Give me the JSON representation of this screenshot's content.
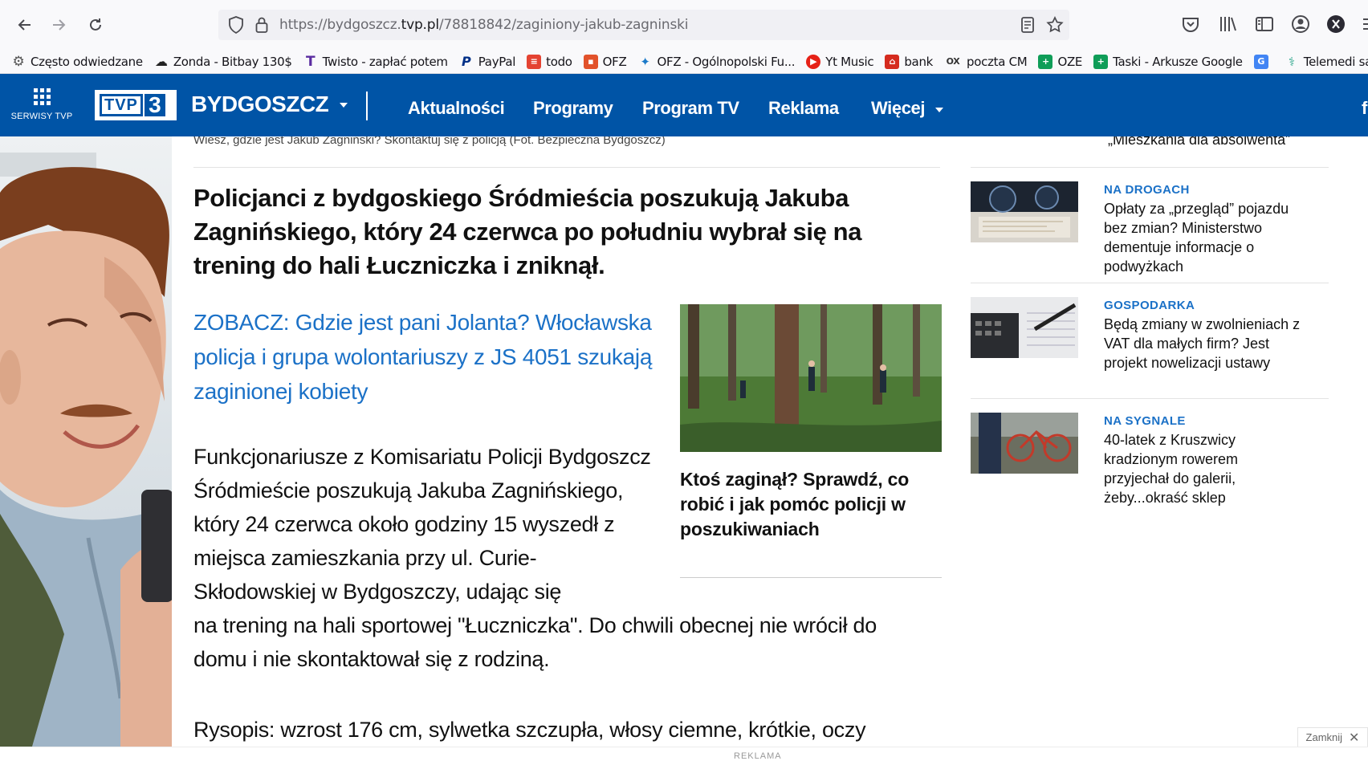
{
  "browser": {
    "url_prefix": "https://bydgoszcz.",
    "url_domain": "tvp.pl",
    "url_path": "/78818842/zaginiony-jakub-zagninski",
    "bookmarks": [
      {
        "label": "Często odwiedzane",
        "icon": "gear-icon",
        "color": "#555555"
      },
      {
        "label": "Zonda - Bitbay 130$",
        "icon": "zonda-icon",
        "color": "#222222"
      },
      {
        "label": "Twisto - zapłać potem",
        "icon": "twisto-icon",
        "color": "#5a2ca0"
      },
      {
        "label": "PayPal",
        "icon": "paypal-icon",
        "color": "#003087"
      },
      {
        "label": "todo",
        "icon": "todo-icon",
        "color": "#e44332"
      },
      {
        "label": "OFZ",
        "icon": "ofz-icon",
        "color": "#e2522b"
      },
      {
        "label": "OFZ - Ogólnopolski Fu...",
        "icon": "ofz2-icon",
        "color": "#1c7ac9"
      },
      {
        "label": "Yt Music",
        "icon": "youtube-music-icon",
        "color": "#e62117"
      },
      {
        "label": "bank",
        "icon": "bank-icon",
        "color": "#d52b1e"
      },
      {
        "label": "poczta CM",
        "icon": "mail-icon",
        "color": "#333333"
      },
      {
        "label": "OZE",
        "icon": "sheets-icon",
        "color": "#0f9d58"
      },
      {
        "label": "Taski - Arkusze Google",
        "icon": "sheets-icon",
        "color": "#0f9d58"
      },
      {
        "label": "",
        "icon": "translate-icon",
        "color": "#4285f4"
      },
      {
        "label": "Telemedi santander",
        "icon": "stethoscope-icon",
        "color": "#2aa58a"
      }
    ]
  },
  "header": {
    "serwisy_label": "SERWISY TVP",
    "logo_text": "TVP",
    "logo_number": "3",
    "region": "BYDGOSZCZ",
    "nav": [
      "Aktualności",
      "Programy",
      "Program TV",
      "Reklama",
      "Więcej"
    ],
    "accent": "#0054a6"
  },
  "article": {
    "photo_caption": "Wiesz, gdzie jest Jakub Zagniński? Skontaktuj się z policją (Fot. Bezpieczna Bydgoszcz)",
    "lead": "Policjanci z bydgoskiego Śródmieścia poszukują Jakuba Zagnińskiego, który 24 czerwca po południu wybrał się na trening do hali Łuczniczka i zniknął.",
    "zobacz": "ZOBACZ: Gdzie jest pani Jolanta? Włocławska policja i grupa wolontariuszy z JS 4051 szukają zaginionej kobiety",
    "body_narrow": "Funkcjonariusze z Komisariatu Policji Bydgoszcz Śródmieście poszukują Jakuba Zagnińskiego, który 24 czerwca około godziny 15 wyszedł z miejsca zamieszkania przy ul. Curie-Skłodowskiej w Bydgoszczy, udając się",
    "body_wide": "na trening na hali sportowej \"Łuczniczka\". Do chwili obecnej nie wrócił do domu i nie skontaktował się z rodziną.",
    "rysopis": "Rysopis: wzrost 176 cm, sylwetka szczupła, włosy ciemne, krótkie, oczy",
    "related_title": "Ktoś zaginął? Sprawdź, co robić i jak pomóc policji w poszukiwaniach"
  },
  "sidebar": {
    "top_fragment": "„Mieszkania dla absolwenta”",
    "items": [
      {
        "category": "NA DROGACH",
        "title": "Opłaty za „przegląd” pojazdu bez zmian? Ministerstwo dementuje informacje o podwyżkach"
      },
      {
        "category": "GOSPODARKA",
        "title": "Będą zmiany w zwolnieniach z VAT dla małych firm? Jest projekt nowelizacji ustawy"
      },
      {
        "category": "NA SYGNALE",
        "title": "40-latek z Kruszwicy kradzionym rowerem przyjechał do galerii, żeby...okraść sklep"
      }
    ]
  },
  "ad": {
    "label": "REKLAMA",
    "close_label": "Zamknij"
  }
}
